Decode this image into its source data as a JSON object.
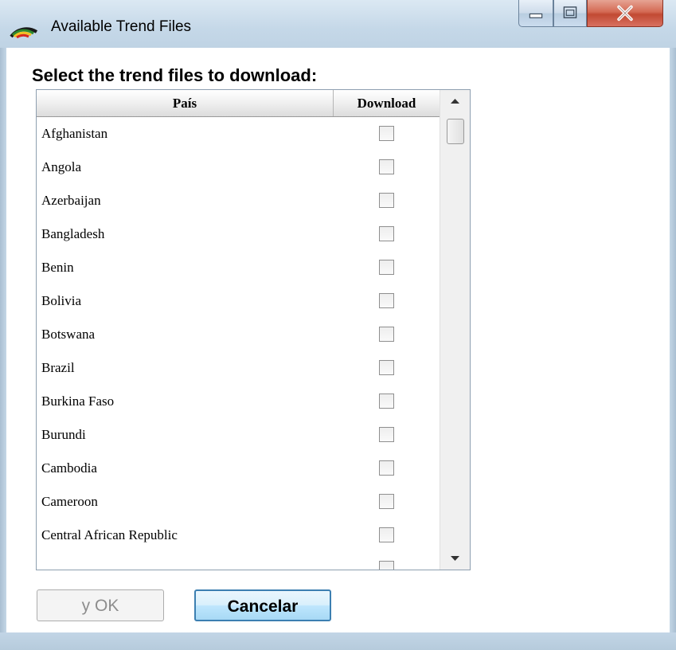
{
  "window": {
    "title": "Available Trend Files"
  },
  "heading": "Select the trend files to download:",
  "grid": {
    "columns": {
      "country": "País",
      "download": "Download"
    },
    "rows": [
      {
        "name": "Afghanistan",
        "checked": false
      },
      {
        "name": "Angola",
        "checked": false
      },
      {
        "name": "Azerbaijan",
        "checked": false
      },
      {
        "name": "Bangladesh",
        "checked": false
      },
      {
        "name": "Benin",
        "checked": false
      },
      {
        "name": "Bolivia",
        "checked": false
      },
      {
        "name": "Botswana",
        "checked": false
      },
      {
        "name": "Brazil",
        "checked": false
      },
      {
        "name": "Burkina Faso",
        "checked": false
      },
      {
        "name": "Burundi",
        "checked": false
      },
      {
        "name": "Cambodia",
        "checked": false
      },
      {
        "name": "Cameroon",
        "checked": false
      },
      {
        "name": "Central African Republic",
        "checked": false
      }
    ]
  },
  "buttons": {
    "ok": "y OK",
    "cancel": "Cancelar"
  },
  "colors": {
    "accent": "#3c7fb1",
    "close_button": "#c14a33"
  },
  "icons": {
    "app": "rainbow-arc-icon",
    "minimize": "minimize-icon",
    "maximize": "maximize-icon",
    "close": "close-icon",
    "scroll_up": "scroll-up-arrow-icon",
    "scroll_down": "scroll-down-arrow-icon"
  }
}
